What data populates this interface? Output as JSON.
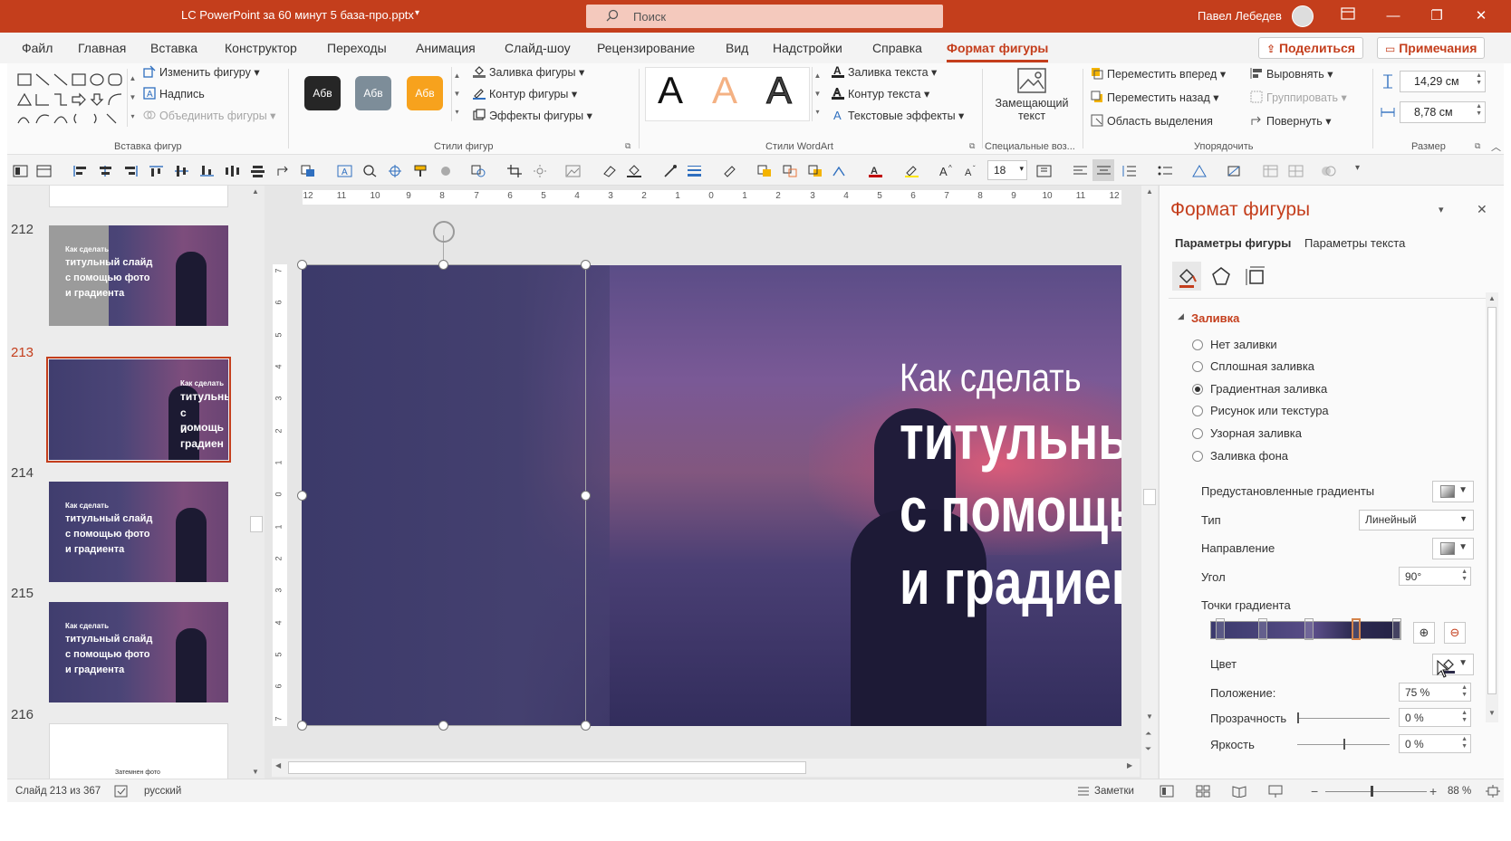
{
  "window": {
    "title": "LC PowerPoint за 60 минут 5 база-про.pptx",
    "search_placeholder": "Поиск",
    "user_name": "Павел Лебедев",
    "accent_color": "#c43e1c"
  },
  "tabs": [
    {
      "label": "Файл"
    },
    {
      "label": "Главная"
    },
    {
      "label": "Вставка"
    },
    {
      "label": "Конструктор"
    },
    {
      "label": "Переходы"
    },
    {
      "label": "Анимация"
    },
    {
      "label": "Слайд-шоу"
    },
    {
      "label": "Рецензирование"
    },
    {
      "label": "Вид"
    },
    {
      "label": "Надстройки"
    },
    {
      "label": "Справка"
    },
    {
      "label": "Формат фигуры"
    }
  ],
  "tab_actions": {
    "share": "Поделиться",
    "comments": "Примечания"
  },
  "ribbon": {
    "insert_shapes": {
      "label": "Вставка фигур",
      "edit_shape": "Изменить фигуру",
      "text_box": "Надпись",
      "merge_shapes": "Объединить фигуры"
    },
    "shape_styles": {
      "label": "Стили фигур",
      "swatch_text": "Абв",
      "fill": "Заливка фигуры",
      "outline": "Контур фигуры",
      "effects": "Эффекты фигуры"
    },
    "wordart": {
      "label": "Стили WordArt",
      "letter": "A",
      "text_fill": "Заливка текста",
      "text_outline": "Контур текста",
      "text_effects": "Текстовые эффекты"
    },
    "accessibility": {
      "label": "Специальные воз...",
      "alt_text_line1": "Замещающий",
      "alt_text_line2": "текст"
    },
    "arrange": {
      "label": "Упорядочить",
      "bring_forward": "Переместить вперед",
      "send_backward": "Переместить назад",
      "selection_pane": "Область выделения",
      "align": "Выровнять",
      "group": "Группировать",
      "rotate": "Повернуть"
    },
    "size": {
      "label": "Размер",
      "height": "14,29 см",
      "width": "8,78 см"
    }
  },
  "qat": {
    "font_size": "18"
  },
  "thumbnails": [
    {
      "number": "212",
      "lines": [
        "Как сделать",
        "титульный слайд",
        "с помощью фото",
        "и градиента"
      ]
    },
    {
      "number": "213",
      "lines": [
        "Как сделать",
        "титульны",
        "с помощь",
        "и градиен"
      ],
      "selected": true
    },
    {
      "number": "214",
      "lines": [
        "Как сделать",
        "титульный слайд",
        "с помощью фото",
        "и градиента"
      ]
    },
    {
      "number": "215",
      "lines": [
        "Как сделать",
        "титульный слайд",
        "с помощью фото",
        "и градиента"
      ]
    },
    {
      "number": "216",
      "lines": [
        "Затемнен фото"
      ]
    }
  ],
  "ruler": {
    "h_ticks": [
      "12",
      "11",
      "10",
      "9",
      "8",
      "7",
      "6",
      "5",
      "4",
      "3",
      "2",
      "1",
      "0",
      "1",
      "2",
      "3",
      "4",
      "5",
      "6",
      "7",
      "8",
      "9",
      "10",
      "11",
      "12"
    ],
    "v_ticks": [
      "7",
      "6",
      "5",
      "4",
      "3",
      "2",
      "1",
      "0",
      "1",
      "2",
      "3",
      "4",
      "5",
      "6",
      "7"
    ]
  },
  "slide": {
    "line1": "Как сделать",
    "line2": "титульный",
    "line3": "с помощью",
    "line4": "и градиент"
  },
  "pane": {
    "title": "Формат фигуры",
    "tab_shape": "Параметры фигуры",
    "tab_text": "Параметры текста",
    "section": "Заливка",
    "fill_options": [
      {
        "label": "Нет заливки",
        "selected": false
      },
      {
        "label": "Сплошная заливка",
        "selected": false
      },
      {
        "label": "Градиентная заливка",
        "selected": true
      },
      {
        "label": "Рисунок или текстура",
        "selected": false
      },
      {
        "label": "Узорная заливка",
        "selected": false
      },
      {
        "label": "Заливка фона",
        "selected": false
      }
    ],
    "preset_gradients": "Предустановленные градиенты",
    "type_label": "Тип",
    "type_value": "Линейный",
    "direction_label": "Направление",
    "angle_label": "Угол",
    "angle_value": "90°",
    "stops_label": "Точки градиента",
    "color_label": "Цвет",
    "position_label": "Положение:",
    "position_value": "75 %",
    "transparency_label": "Прозрачность",
    "transparency_value": "0 %",
    "brightness_label": "Яркость",
    "brightness_value": "0 %"
  },
  "status": {
    "slide_info": "Слайд 213 из 367",
    "language": "русский",
    "notes": "Заметки",
    "zoom": "88 %"
  }
}
